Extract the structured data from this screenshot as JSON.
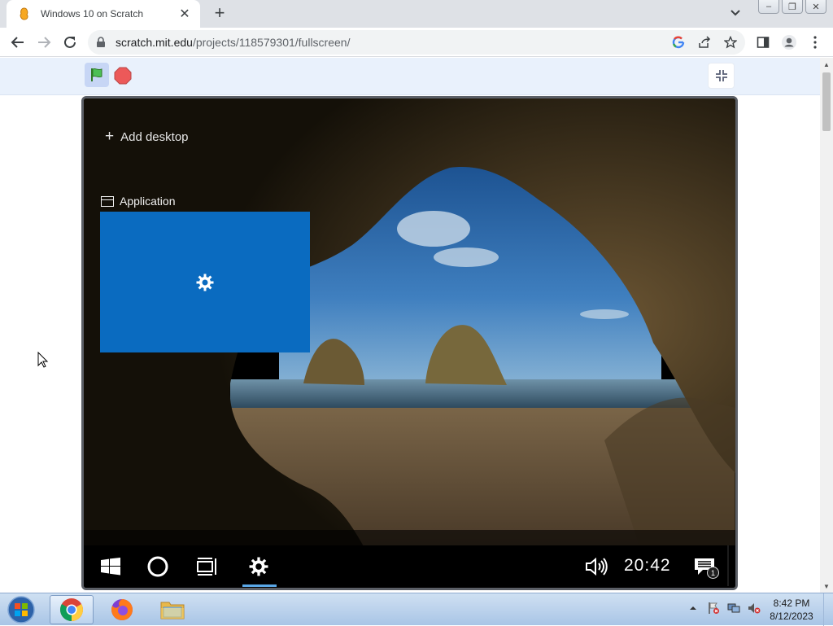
{
  "browser": {
    "tab_title": "Windows 10 on Scratch",
    "url_host": "scratch.mit.edu",
    "url_path": "/projects/118579301/fullscreen/"
  },
  "stage": {
    "add_desktop_label": "Add desktop",
    "app_label": "Application",
    "clock": "20:42",
    "notification_count": "1"
  },
  "os_taskbar": {
    "time": "8:42 PM",
    "date": "8/12/2023"
  },
  "colors": {
    "app_tile": "#0a6bc0",
    "scratch_menu": "#e9f1fc",
    "settings_underline": "#5aa7e6"
  }
}
